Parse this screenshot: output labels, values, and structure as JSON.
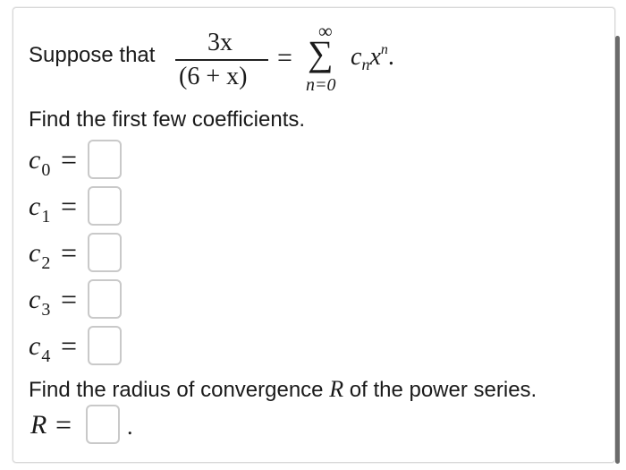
{
  "problem": {
    "intro": "Suppose that",
    "numerator": "3x",
    "denominator": "(6 + x)",
    "equals": "=",
    "sum_upper": "∞",
    "sum_symbol": "∑",
    "sum_lower": "n=0",
    "term_c": "c",
    "term_c_sub": "n",
    "term_x": "x",
    "term_x_sup": "n",
    "period": "."
  },
  "coefficients": {
    "instruction": "Find the first few coefficients.",
    "rows": [
      {
        "letter": "c",
        "index": "0",
        "equals": "="
      },
      {
        "letter": "c",
        "index": "1",
        "equals": "="
      },
      {
        "letter": "c",
        "index": "2",
        "equals": "="
      },
      {
        "letter": "c",
        "index": "3",
        "equals": "="
      },
      {
        "letter": "c",
        "index": "4",
        "equals": "="
      }
    ]
  },
  "radius": {
    "instruction_before": "Find the radius of convergence",
    "instruction_var": "R",
    "instruction_after": "of the power series.",
    "label": "R",
    "equals": "=",
    "period": "."
  }
}
